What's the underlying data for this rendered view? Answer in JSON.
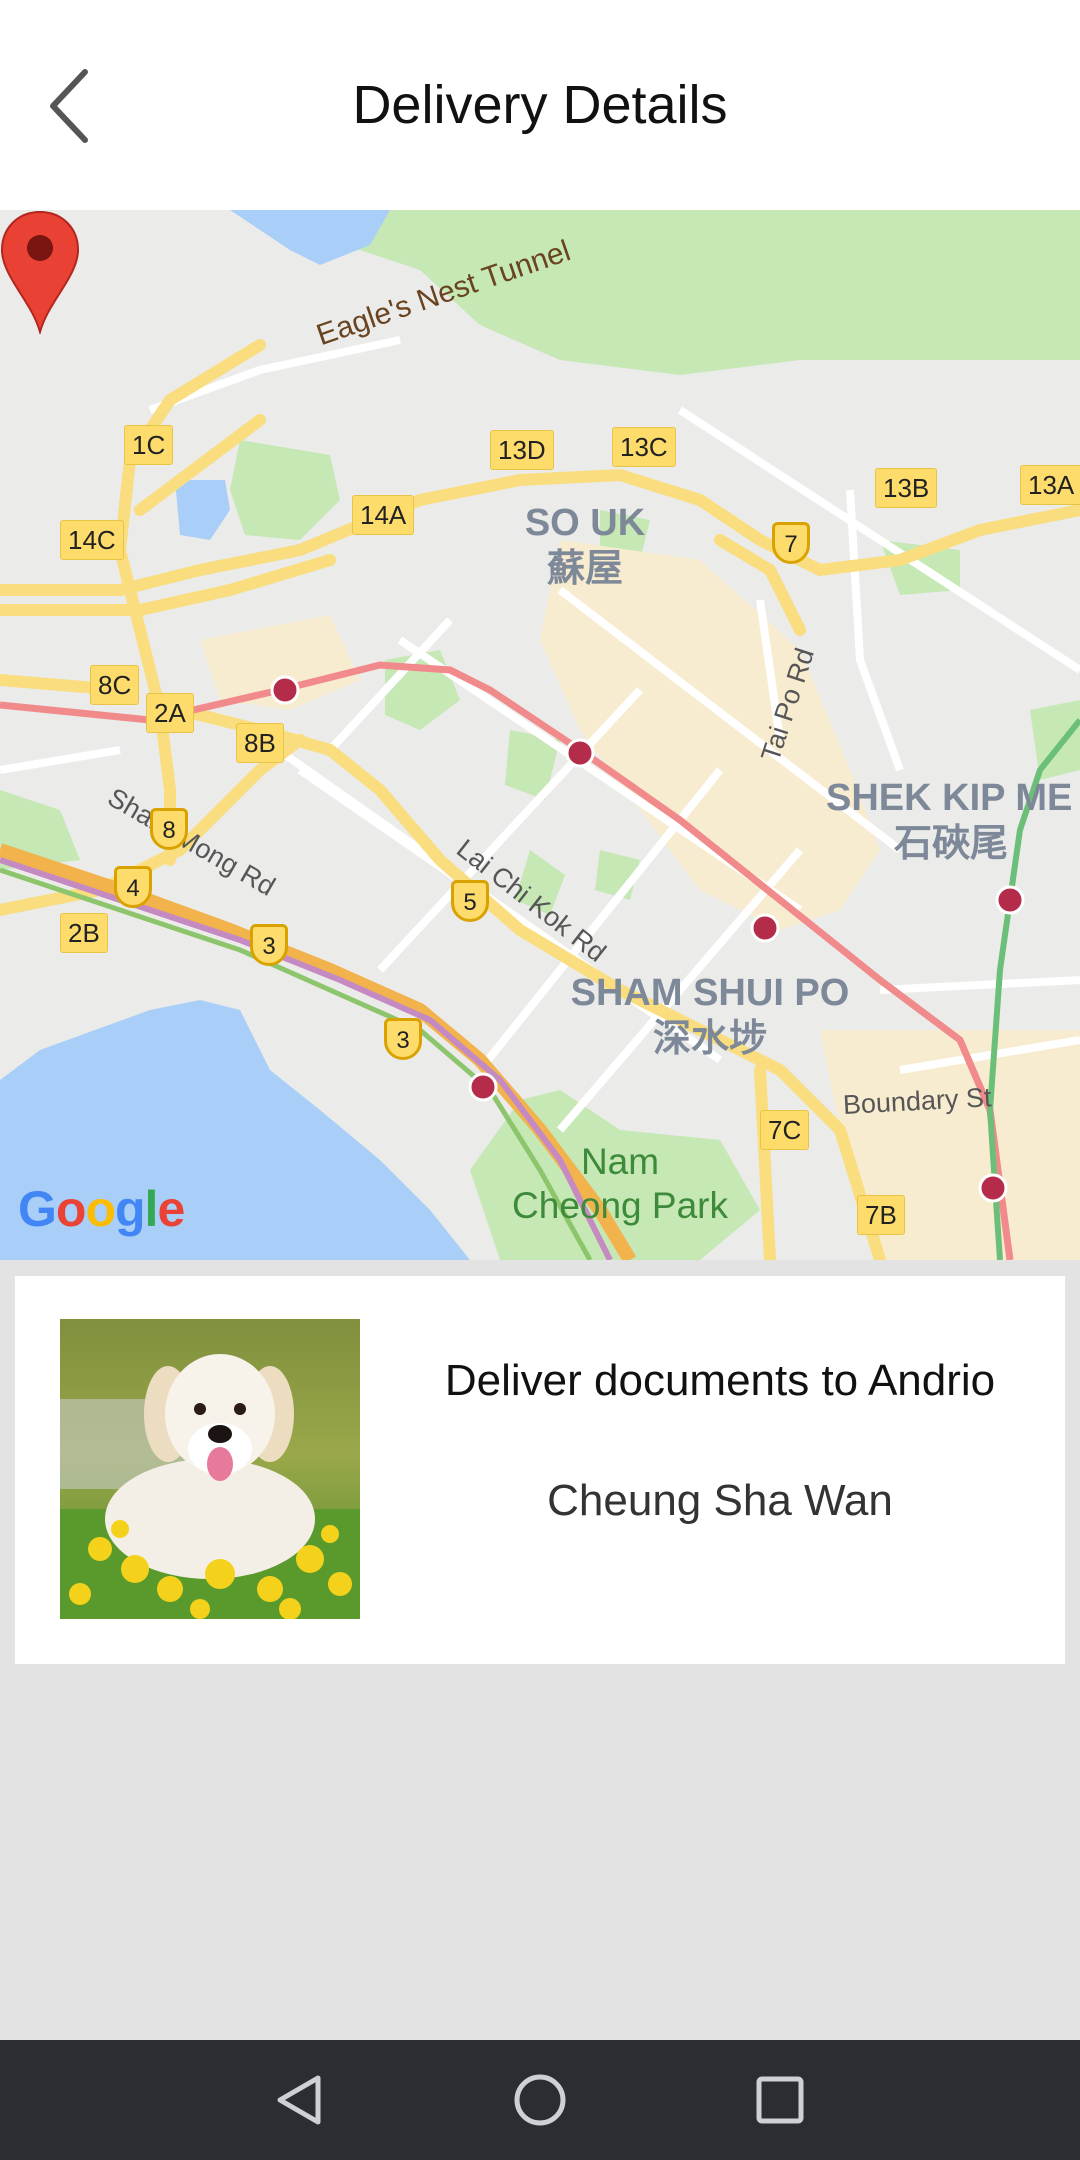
{
  "header": {
    "title": "Delivery Details",
    "back_icon": "chevron-left-icon"
  },
  "map": {
    "attribution": "Google",
    "districts": [
      {
        "en": "SO UK",
        "zh": "蘇屋"
      },
      {
        "en": "SHEK KIP ME",
        "zh": "石硤尾"
      },
      {
        "en": "SHAM SHUI PO",
        "zh": "深水埗"
      }
    ],
    "roads": [
      "Eagle's Nest Tunnel",
      "Sham Mong Rd",
      "Lai Chi Kok Rd",
      "Tai Po Rd",
      "Boundary St"
    ],
    "park": {
      "line1": "Nam",
      "line2": "Cheong Park"
    },
    "exits": [
      "1C",
      "13D",
      "13C",
      "13B",
      "13A",
      "14C",
      "14A",
      "8C",
      "2A",
      "8B",
      "2B",
      "7C",
      "7B"
    ],
    "route_shields": [
      "7",
      "8",
      "4",
      "3",
      "5",
      "3"
    ],
    "marker_icon": "map-pin-icon"
  },
  "card": {
    "title": "Deliver documents to Andrio",
    "subtitle": "Cheung Sha Wan",
    "image_icon": "dog-photo"
  },
  "navbar": {
    "back_icon": "triangle-back-icon",
    "home_icon": "circle-home-icon",
    "recents_icon": "square-recents-icon"
  }
}
